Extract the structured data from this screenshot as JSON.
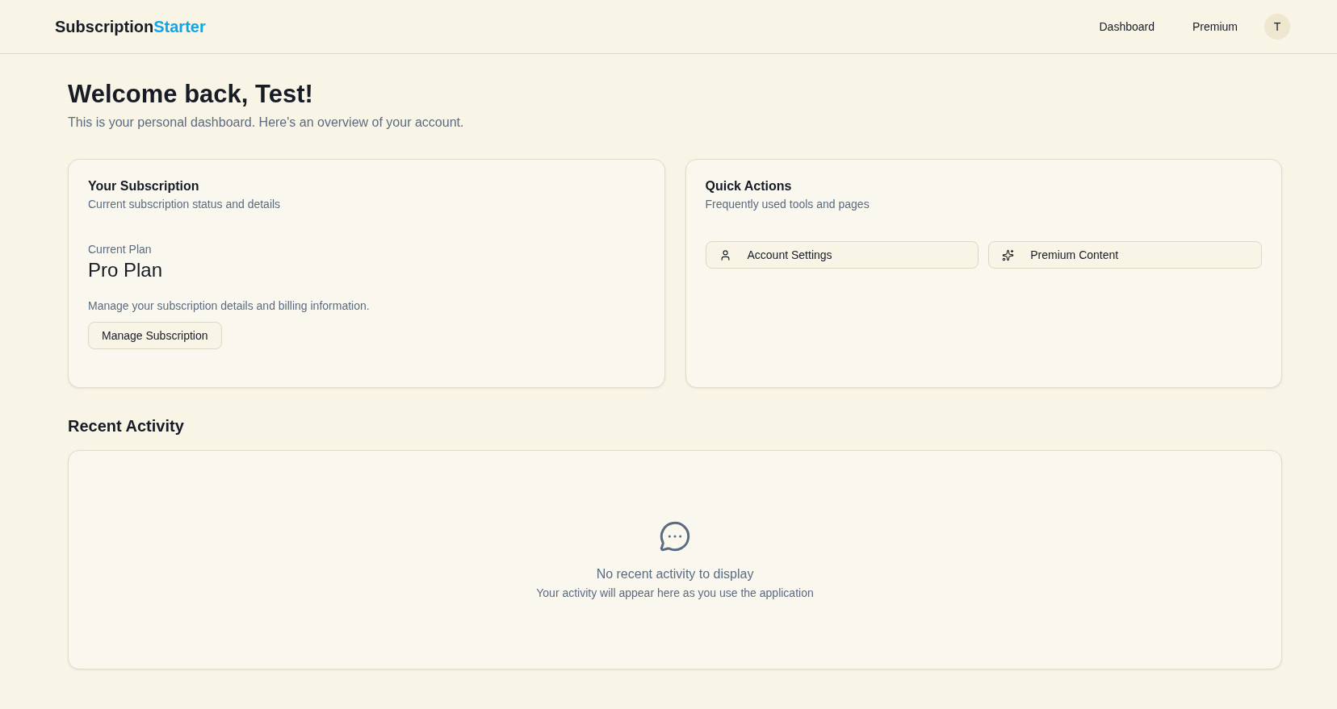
{
  "header": {
    "brand": "Subscription",
    "brand_accent": "Starter",
    "nav": [
      "Dashboard",
      "Premium"
    ],
    "avatar": "T"
  },
  "welcome": {
    "title": "Welcome back, Test!",
    "subtitle": "This is your personal dashboard. Here's an overview of your account."
  },
  "subscription": {
    "title": "Your Subscription",
    "description": "Current subscription status and details",
    "plan_label": "Current Plan",
    "plan": "Pro Plan",
    "note": "Manage your subscription details and billing information.",
    "button": "Manage Subscription"
  },
  "quick_actions": {
    "title": "Quick Actions",
    "description": "Frequently used tools and pages",
    "actions": [
      {
        "kind": "user",
        "label": "Account Settings"
      },
      {
        "kind": "sparkles",
        "label": "Premium Content"
      }
    ]
  },
  "recent_activity": {
    "title": "Recent Activity",
    "empty_title": "No recent activity to display",
    "empty_text": "Your activity will appear here as you use the application"
  }
}
